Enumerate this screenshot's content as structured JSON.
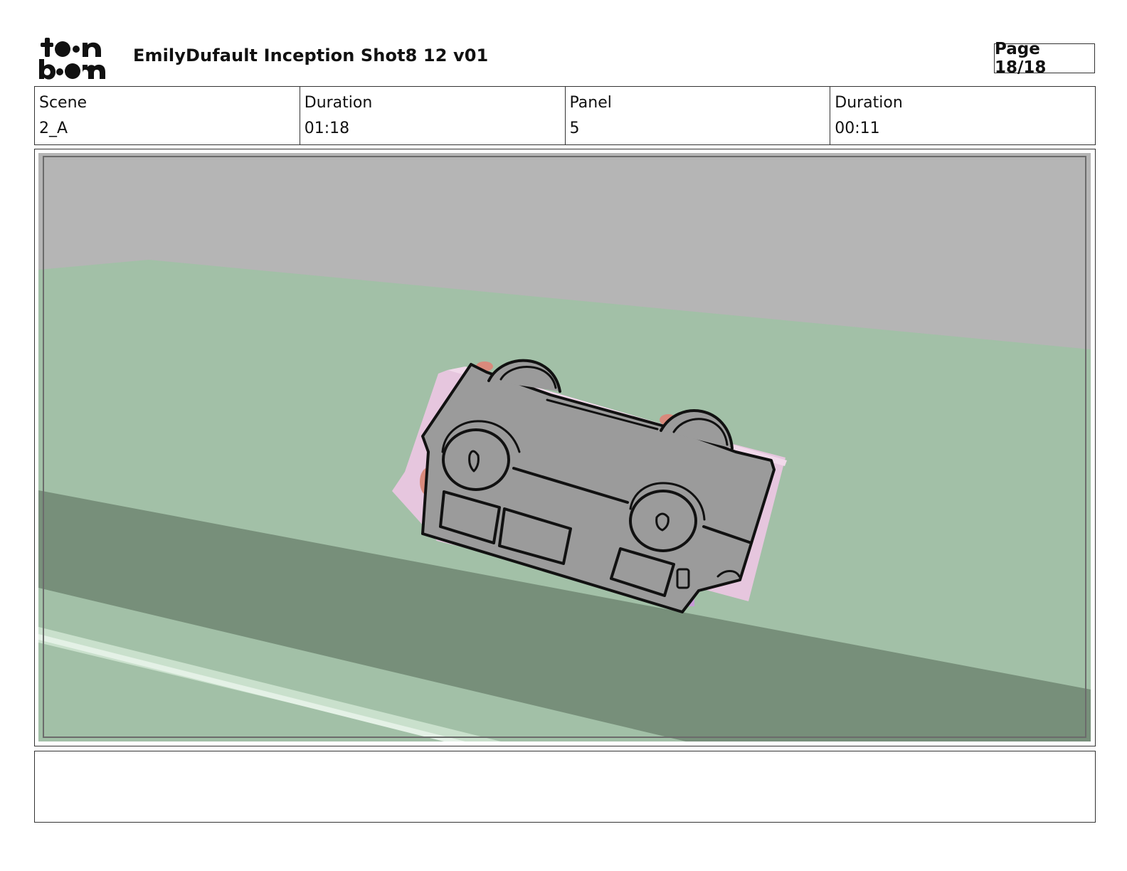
{
  "header": {
    "logo_text": "toon boom",
    "title": "EmilyDufault Inception Shot8 12 v01",
    "page_label": "Page 18/18"
  },
  "info": {
    "scene_label": "Scene",
    "scene_value": "2_A",
    "scene_duration_label": "Duration",
    "scene_duration_value": "01:18",
    "panel_label": "Panel",
    "panel_value": "5",
    "panel_duration_label": "Duration",
    "panel_duration_value": "00:11"
  },
  "colors": {
    "sky": "#b5b5b5",
    "ground": "#a2c0a7",
    "road_shadow": "#778f7a",
    "car_body": "#9b9b9b",
    "car_underside": "#e6c6de",
    "outline": "#111111"
  },
  "notes": {
    "text": ""
  }
}
